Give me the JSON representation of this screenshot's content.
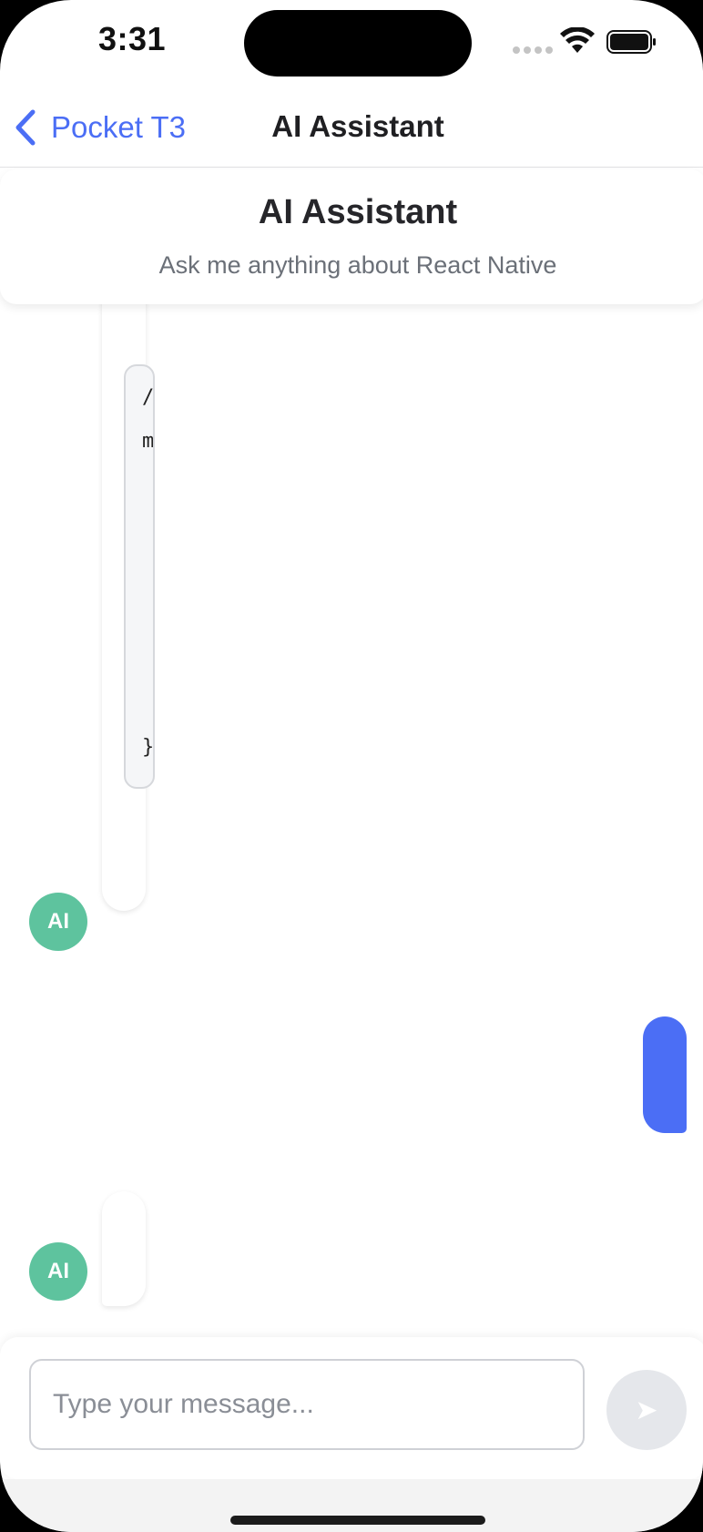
{
  "status_bar": {
    "time": "3:31"
  },
  "nav": {
    "back_label": "Pocket T3",
    "title": "AI Assistant"
  },
  "header": {
    "title": "AI Assistant",
    "subtitle": "Ask me anything about React Native"
  },
  "messages": [
    {
      "role": "ai",
      "avatar": "AI",
      "code_lines": [
        "/",
        "m",
        "}"
      ]
    },
    {
      "role": "user"
    },
    {
      "role": "ai",
      "avatar": "AI"
    }
  ],
  "composer": {
    "placeholder": "Type your message...",
    "value": "",
    "send_icon": "➤"
  },
  "colors": {
    "accent": "#4b6ef5",
    "avatar": "#5ec39e",
    "send_disabled": "#e5e7eb"
  },
  "icons": [
    "chevron-left-icon",
    "wifi-icon",
    "battery-icon",
    "send-icon"
  ]
}
